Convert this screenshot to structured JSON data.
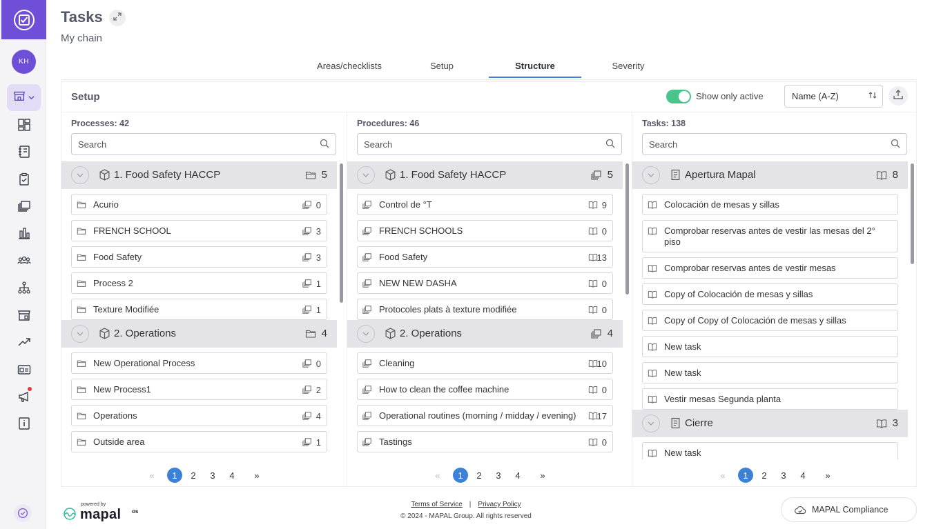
{
  "app": {
    "title": "Tasks",
    "subtitle": "My chain"
  },
  "sidebar": {
    "avatar_initials": "KH",
    "icons": [
      "store-icon",
      "dashboard-icon",
      "notebook-icon",
      "checklist-icon",
      "gallery-icon",
      "bar-chart-icon",
      "people-icon",
      "org-tree-icon",
      "shop-icon",
      "trending-icon",
      "id-card-icon",
      "megaphone-icon",
      "info-icon"
    ]
  },
  "tabs": [
    {
      "label": "Areas/checklists",
      "active": false
    },
    {
      "label": "Setup",
      "active": false
    },
    {
      "label": "Structure",
      "active": true
    },
    {
      "label": "Severity",
      "active": false
    }
  ],
  "panel": {
    "title": "Setup",
    "toggle_label": "Show only active",
    "toggle_on": true,
    "sort_value": "Name (A-Z)"
  },
  "columns": [
    {
      "count_label": "Processes: 42",
      "search_placeholder": "Search",
      "groups": [
        {
          "name": "1. Food Safety HACCP",
          "count": "5",
          "items": [
            {
              "name": "Acurio",
              "count": "0"
            },
            {
              "name": "FRENCH SCHOOL",
              "count": "3"
            },
            {
              "name": "Food Safety",
              "count": "3"
            },
            {
              "name": "Process 2",
              "count": "1"
            },
            {
              "name": "Texture Modifiée",
              "count": "1"
            }
          ]
        },
        {
          "name": "2. Operations",
          "count": "4",
          "items": [
            {
              "name": "New Operational Process",
              "count": "0"
            },
            {
              "name": "New Process1",
              "count": "2"
            },
            {
              "name": "Operations",
              "count": "4"
            },
            {
              "name": "Outside area",
              "count": "1"
            }
          ]
        }
      ],
      "pages": [
        "1",
        "2",
        "3",
        "4"
      ]
    },
    {
      "count_label": "Procedures: 46",
      "search_placeholder": "Search",
      "groups": [
        {
          "name": "1. Food Safety HACCP",
          "count": "5",
          "items": [
            {
              "name": "Control de °T",
              "count": "9"
            },
            {
              "name": "FRENCH SCHOOLS",
              "count": "0"
            },
            {
              "name": "Food Safety",
              "count": "13"
            },
            {
              "name": "NEW NEW DASHA",
              "count": "0"
            },
            {
              "name": "Protocoles plats à texture modifiée",
              "count": "0"
            }
          ]
        },
        {
          "name": "2. Operations",
          "count": "4",
          "items": [
            {
              "name": "Cleaning",
              "count": "10"
            },
            {
              "name": "How to clean the coffee machine",
              "count": "0"
            },
            {
              "name": "Operational routines (morning / midday / evening)",
              "count": "17"
            },
            {
              "name": "Tastings",
              "count": "0"
            }
          ]
        }
      ],
      "pages": [
        "1",
        "2",
        "3",
        "4"
      ]
    },
    {
      "count_label": "Tasks: 138",
      "search_placeholder": "Search",
      "groups": [
        {
          "name": "Apertura Mapal",
          "count": "8",
          "items": [
            {
              "name": "Colocación de mesas y sillas"
            },
            {
              "name": "Comprobar reservas antes de vestir las mesas del 2° piso"
            },
            {
              "name": "Comprobar reservas antes de vestir mesas"
            },
            {
              "name": "Copy of Colocación de mesas y sillas"
            },
            {
              "name": "Copy of Copy of Colocación de mesas y sillas"
            },
            {
              "name": "New task"
            },
            {
              "name": "New task"
            },
            {
              "name": "Vestir mesas Segunda planta"
            }
          ]
        },
        {
          "name": "Cierre",
          "count": "3",
          "items": [
            {
              "name": "New task"
            }
          ]
        }
      ],
      "pages": [
        "1",
        "2",
        "3",
        "4"
      ]
    }
  ],
  "pager": {
    "prev": "«",
    "next": "»",
    "active_page": "1"
  },
  "footer": {
    "powered_by": "powered by",
    "brand": "mapal",
    "brand_suffix": "os",
    "terms": "Terms of Service",
    "separator": "|",
    "privacy": "Privacy Policy",
    "copyright": "© 2024 - MAPAL Group. All rights reserved",
    "compliance_button": "MAPAL Compliance"
  },
  "colors": {
    "accent": "#6f4fd8",
    "link_blue": "#3b82d6",
    "toggle_green": "#49c48a"
  }
}
